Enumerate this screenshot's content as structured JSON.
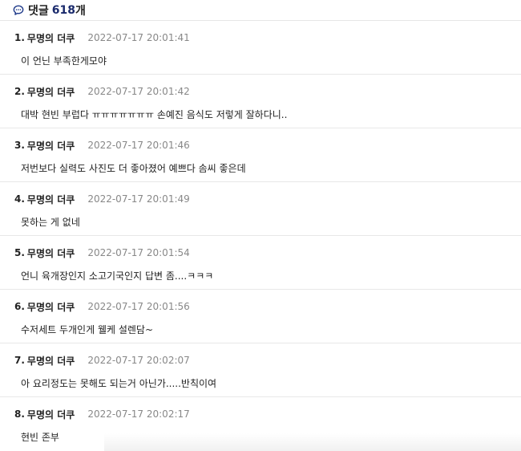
{
  "header": {
    "icon": "speech-bubble-icon",
    "label": "댓글",
    "count": "618",
    "unit": "개",
    "accent_color": "#1a2a6c"
  },
  "comments": [
    {
      "index": "1.",
      "author": "무명의 더쿠",
      "date": "2022-07-17 20:01:41",
      "text": "이 언닌 부족한게모야"
    },
    {
      "index": "2.",
      "author": "무명의 더쿠",
      "date": "2022-07-17 20:01:42",
      "text": "대박 현빈 부럽다 ㅠㅠㅠㅠㅠㅠㅠ 손예진 음식도 저렇게 잘하다니.."
    },
    {
      "index": "3.",
      "author": "무명의 더쿠",
      "date": "2022-07-17 20:01:46",
      "text": "저번보다 실력도 사진도 더 좋아졌어 예쁘다 솜씨 좋은데"
    },
    {
      "index": "4.",
      "author": "무명의 더쿠",
      "date": "2022-07-17 20:01:49",
      "text": "못하는 게 없네"
    },
    {
      "index": "5.",
      "author": "무명의 더쿠",
      "date": "2022-07-17 20:01:54",
      "text": "언니 육개장인지 소고기국인지 답변 좀....ㅋㅋㅋ"
    },
    {
      "index": "6.",
      "author": "무명의 더쿠",
      "date": "2022-07-17 20:01:56",
      "text": "수저세트 두개인게 웰케 설렌담~"
    },
    {
      "index": "7.",
      "author": "무명의 더쿠",
      "date": "2022-07-17 20:02:07",
      "text": "아 요리정도는 못해도 되는거 아닌가.....반칙이여"
    },
    {
      "index": "8.",
      "author": "무명의 더쿠",
      "date": "2022-07-17 20:02:17",
      "text": "현빈 존부"
    }
  ]
}
